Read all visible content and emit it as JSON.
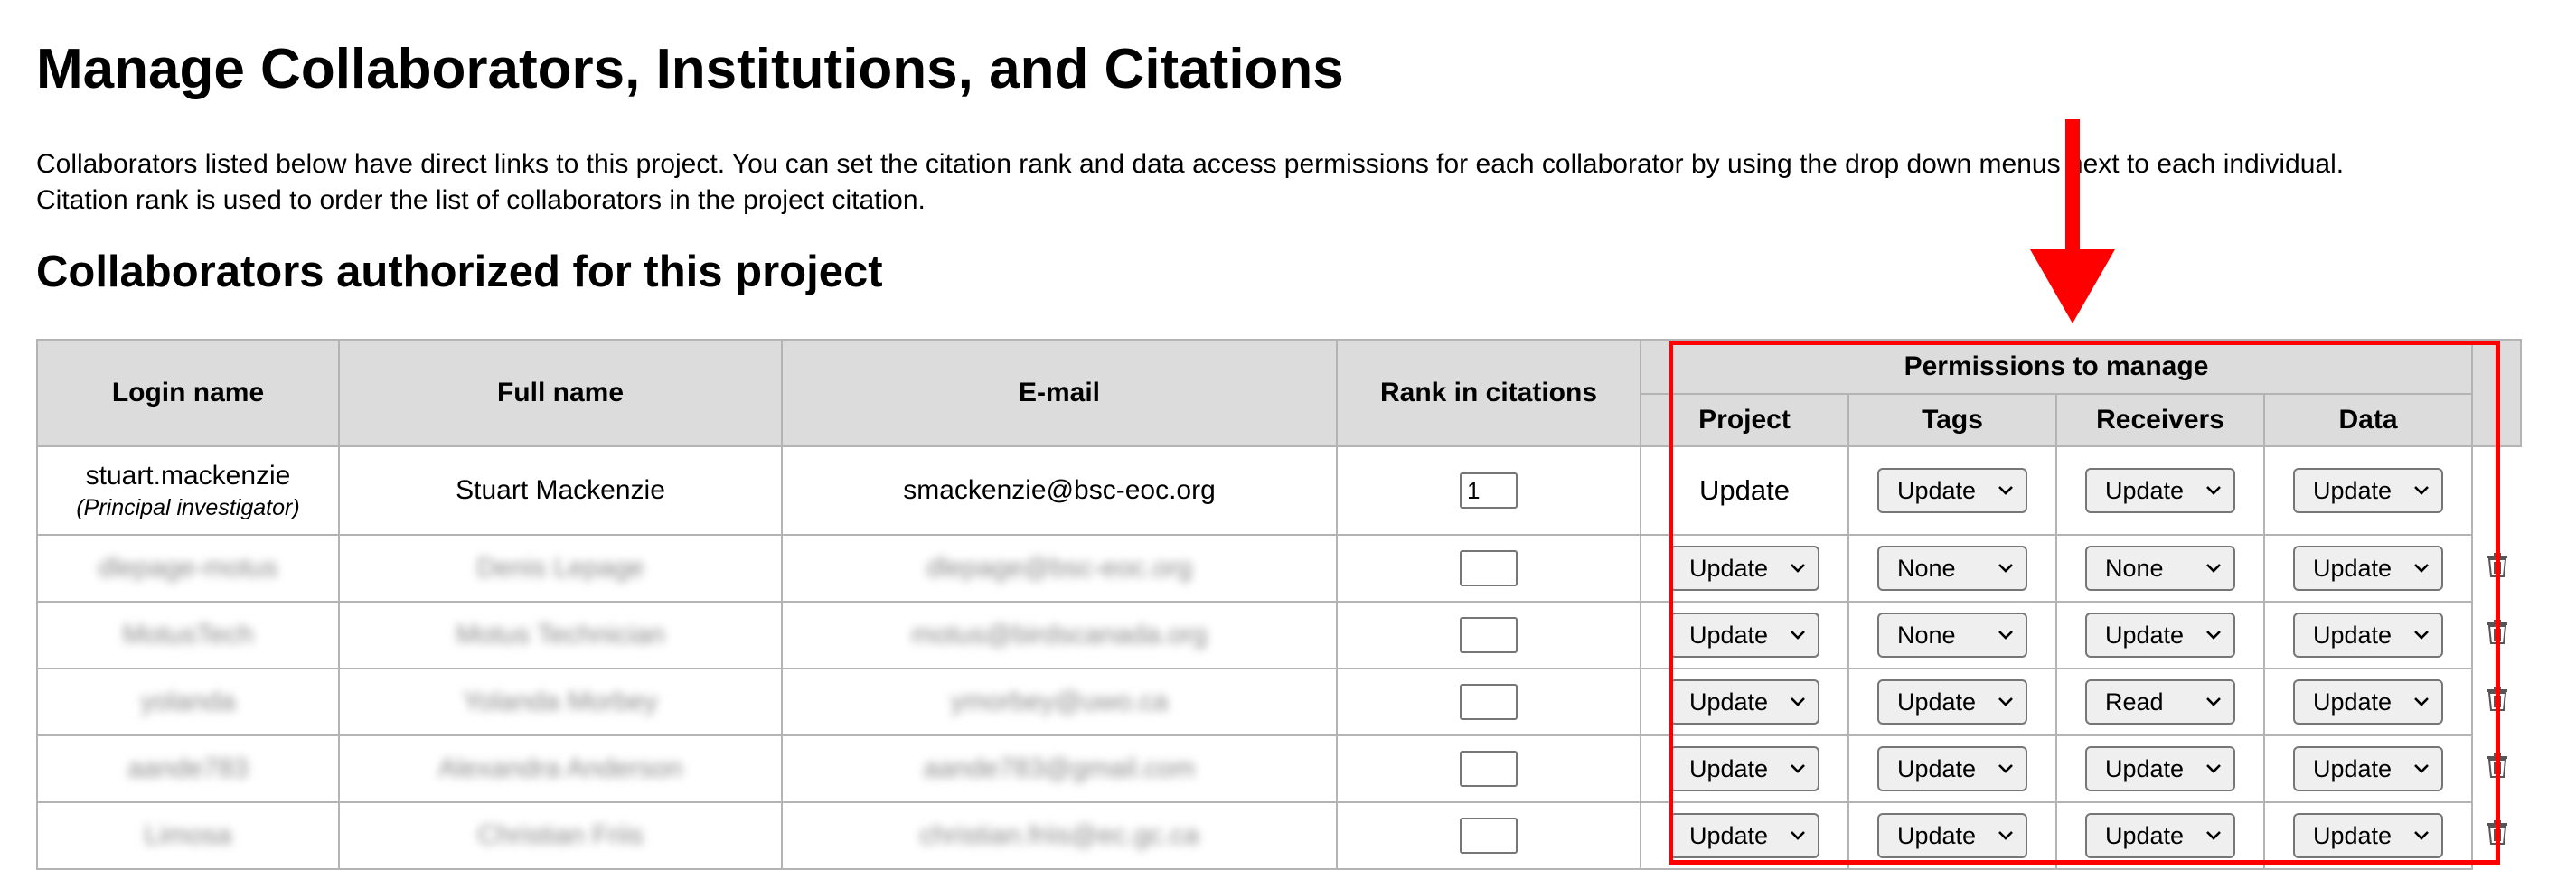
{
  "page": {
    "title": "Manage Collaborators, Institutions, and Citations",
    "intro_line1": "Collaborators listed below have direct links to this project. You can set the citation rank and data access permissions for each collaborator by using the drop down menus next to each individual.",
    "intro_line2": "Citation rank is used to order the list of collaborators in the project citation.",
    "section_title": "Collaborators authorized for this project"
  },
  "table": {
    "headers": {
      "login": "Login name",
      "full_name": "Full name",
      "email": "E-mail",
      "rank": "Rank in citations",
      "permissions": "Permissions to manage",
      "project": "Project",
      "tags": "Tags",
      "receivers": "Receivers",
      "data": "Data"
    },
    "principal": {
      "login": "stuart.mackenzie",
      "role": "(Principal investigator)",
      "full_name": "Stuart Mackenzie",
      "email": "smackenzie@bsc-eoc.org",
      "rank": "1",
      "project": "Update",
      "tags": "Update",
      "receivers": "Update",
      "data": "Update"
    },
    "rows": [
      {
        "login": "dlepage-motus",
        "full_name": "Denis Lepage",
        "email": "dlepage@bsc-eoc.org",
        "rank": "",
        "project": "Update",
        "tags": "None",
        "receivers": "None",
        "data": "Update"
      },
      {
        "login": "MotusTech",
        "full_name": "Motus Technician",
        "email": "motus@birdscanada.org",
        "rank": "",
        "project": "Update",
        "tags": "None",
        "receivers": "Update",
        "data": "Update"
      },
      {
        "login": "yolanda",
        "full_name": "Yolanda Morbey",
        "email": "ymorbey@uwo.ca",
        "rank": "",
        "project": "Update",
        "tags": "Update",
        "receivers": "Read",
        "data": "Update"
      },
      {
        "login": "aande783",
        "full_name": "Alexandra Anderson",
        "email": "aande783@gmail.com",
        "rank": "",
        "project": "Update",
        "tags": "Update",
        "receivers": "Update",
        "data": "Update"
      },
      {
        "login": "Limosa",
        "full_name": "Christian Friis",
        "email": "christian.friis@ec.gc.ca",
        "rank": "",
        "project": "Update",
        "tags": "Update",
        "receivers": "Update",
        "data": "Update"
      }
    ]
  },
  "icons": {
    "delete": "trash-icon",
    "dropdown": "chevron-down-icon",
    "annotation_arrow": "arrow-down-icon"
  },
  "colors": {
    "annotation": "#ff0000",
    "header_bg": "#dcdcdc",
    "select_bg": "#efefef"
  }
}
